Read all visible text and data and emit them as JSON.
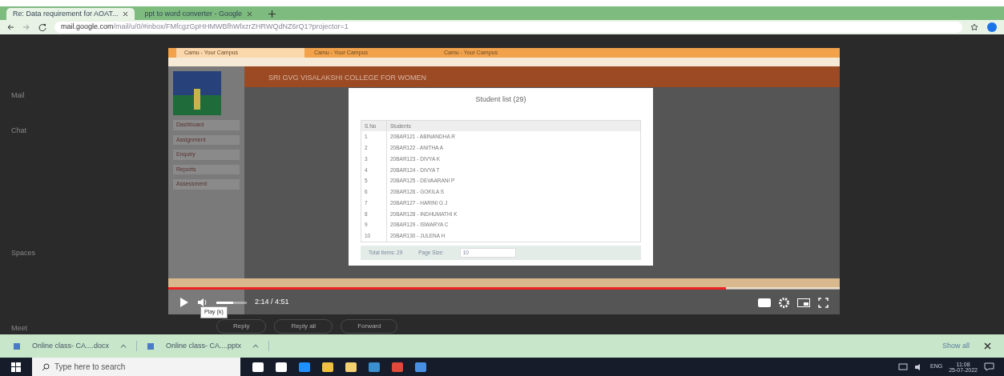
{
  "browser_tabs": [
    {
      "title": "Re: Data requirement for AOAT...",
      "selected": true
    },
    {
      "title": "ppt to word converter - Google",
      "selected": false
    }
  ],
  "address_bar": {
    "host": "mail.google.com",
    "path": "/mail/u/0/#inbox/FMfcgzGpHHMWBfhWlxzrZHRWQdNZ6rQ1?projector=1"
  },
  "gmail_sections": [
    "Mail",
    "Chat",
    "Spaces",
    "Meet"
  ],
  "video": {
    "inner_tabs": [
      {
        "title": "Camu - Your Campus",
        "selected": true
      },
      {
        "title": "Camu - Your Campus",
        "selected": false
      },
      {
        "title": "Camu - Your Campus",
        "selected": false
      }
    ],
    "college": "SRI GVG VISALAKSHI COLLEGE FOR WOMEN",
    "menu": [
      "Dashboard",
      "Assignment",
      "Enquiry",
      "Reports",
      "Assessment"
    ],
    "modal": {
      "title": "Student list (29)",
      "columns": [
        "S.No",
        "Students"
      ],
      "rows": [
        [
          "1",
          "20BAR121 - ABINANDHA R"
        ],
        [
          "2",
          "20BAR122 - ANITHA A"
        ],
        [
          "3",
          "20BAR123 - DIVYA K"
        ],
        [
          "4",
          "20BAR124 - DIVYA T"
        ],
        [
          "5",
          "20BAR125 - DEVAARANI P"
        ],
        [
          "6",
          "20BAR126 - GOKILA S"
        ],
        [
          "7",
          "20BAR127 - HARINI G J"
        ],
        [
          "8",
          "20BAR128 - INDHUMATHI K"
        ],
        [
          "9",
          "20BAR129 - ISWARYA C"
        ],
        [
          "10",
          "20BAR130 - JULENA H"
        ]
      ],
      "total": "Total Items: 29",
      "page_size_label": "Page Size:",
      "page_size": "10"
    },
    "player": {
      "progress": {
        "level": 0.83
      },
      "volume": {
        "level": 0.55
      },
      "time": "2:14 / 4:51",
      "tooltip": "Play (k)"
    }
  },
  "actions": [
    "Reply",
    "Reply all",
    "Forward"
  ],
  "downloads": [
    {
      "name": "Online class- CA....docx"
    },
    {
      "name": "Online class- CA....pptx"
    }
  ],
  "show_all": "Show all",
  "taskbar": {
    "search_placeholder": "Type here to search",
    "language": "ENG",
    "time": "11:08",
    "date": "25-07-2022"
  }
}
